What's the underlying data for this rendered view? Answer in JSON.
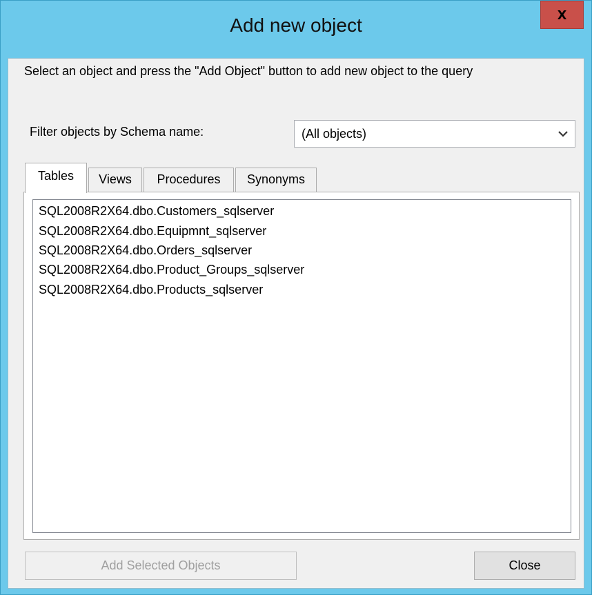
{
  "window": {
    "title": "Add new object",
    "close_label": "x"
  },
  "instructions": "Select an object and press the \"Add Object\" button to add new object to the query",
  "filter": {
    "label": "Filter objects by Schema name:",
    "selected": "(All objects)"
  },
  "tabs": [
    {
      "label": "Tables",
      "active": true
    },
    {
      "label": "Views",
      "active": false
    },
    {
      "label": "Procedures",
      "active": false
    },
    {
      "label": "Synonyms",
      "active": false
    }
  ],
  "objects": [
    "SQL2008R2X64.dbo.Customers_sqlserver",
    "SQL2008R2X64.dbo.Equipmnt_sqlserver",
    "SQL2008R2X64.dbo.Orders_sqlserver",
    "SQL2008R2X64.dbo.Product_Groups_sqlserver",
    "SQL2008R2X64.dbo.Products_sqlserver"
  ],
  "buttons": {
    "add_selected": "Add Selected Objects",
    "close": "Close"
  },
  "colors": {
    "title_bar": "#6cc9eb",
    "close_button": "#c9504a",
    "dialog_background": "#f0f0f0"
  }
}
